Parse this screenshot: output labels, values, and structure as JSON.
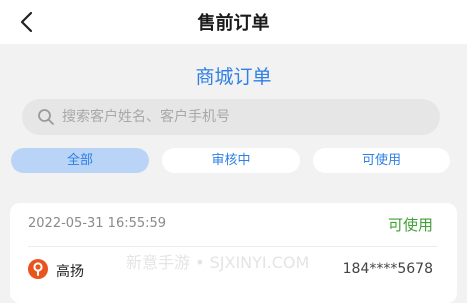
{
  "header": {
    "title": "售前订单",
    "back_icon": "chevron-left-icon"
  },
  "section": {
    "title": "商城订单"
  },
  "search": {
    "placeholder": "搜索客户姓名、客户手机号",
    "value": "",
    "icon": "search-icon"
  },
  "tabs": [
    {
      "label": "全部",
      "active": true
    },
    {
      "label": "审核中",
      "active": false
    },
    {
      "label": "可使用",
      "active": false
    }
  ],
  "order": {
    "time": "2022-05-31 16:55:59",
    "status": "可使用",
    "customer_name": "高扬",
    "customer_phone": "184****5678",
    "customer_icon": "person-badge-icon"
  },
  "watermark": "新意手游 • SJXINYI.COM",
  "colors": {
    "accent": "#2f7fe6",
    "status_green": "#3fa035",
    "customer_icon": "#e8531e",
    "tab_active_bg": "#b9d4f7"
  }
}
